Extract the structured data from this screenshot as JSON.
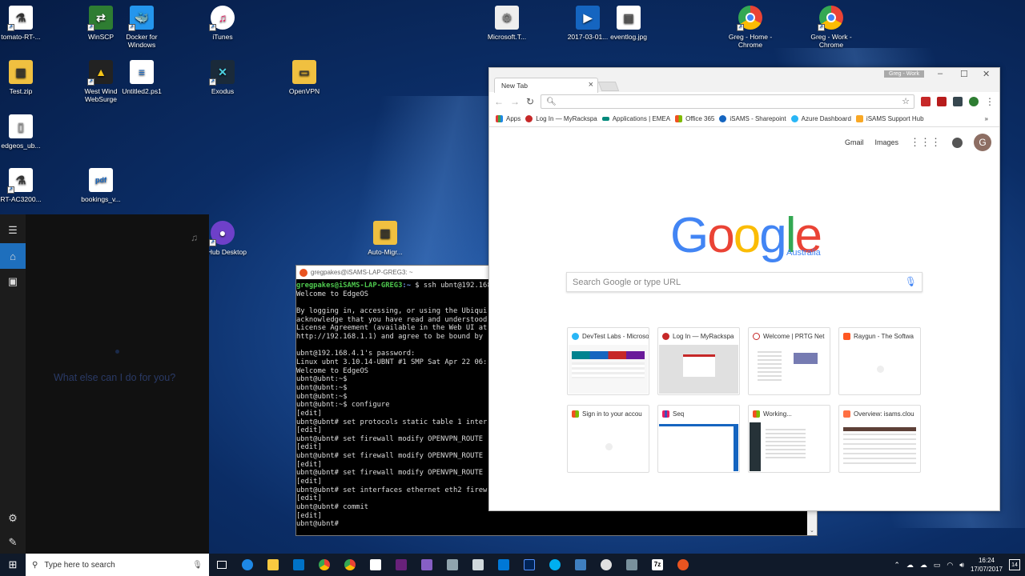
{
  "desktop": {
    "icons": [
      {
        "label": "tomato-RT-..."
      },
      {
        "label": "WinSCP"
      },
      {
        "label": "Docker for Windows"
      },
      {
        "label": "iTunes"
      },
      {
        "label": "Test.zip"
      },
      {
        "label": "West Wind WebSurge"
      },
      {
        "label": "Untitled2.ps1"
      },
      {
        "label": "Exodus"
      },
      {
        "label": "OpenVPN"
      },
      {
        "label": "edgeos_ub..."
      },
      {
        "label": "RT-AC3200..."
      },
      {
        "label": "bookings_v..."
      },
      {
        "label": "GitHub Desktop"
      },
      {
        "label": "Auto-Migr..."
      },
      {
        "label": "Microsoft.T..."
      },
      {
        "label": "2017-03-01..."
      },
      {
        "label": "eventlog.jpg"
      },
      {
        "label": "Greg - Home - Chrome"
      },
      {
        "label": "Greg - Work - Chrome"
      }
    ]
  },
  "cortana": {
    "prompt": "What else can I do for you?"
  },
  "terminal": {
    "title": "gregpakes@iSAMS-LAP-GREG3: ~",
    "prompt_user": "gregpakes@iSAMS-LAP-GREG3",
    "prompt_path": ":~",
    "first_command": "$ ssh ubnt@192.168",
    "lines": [
      "Welcome to EdgeOS",
      "",
      "By logging in, accessing, or using the Ubiqui",
      "acknowledge that you have read and understood",
      "License Agreement (available in the Web UI at",
      "http://192.168.1.1) and agree to be bound by",
      "",
      "ubnt@192.168.4.1's password:",
      "Linux ubnt 3.10.14-UBNT #1 SMP Sat Apr 22 06:",
      "Welcome to EdgeOS",
      "ubnt@ubnt:~$",
      "ubnt@ubnt:~$",
      "ubnt@ubnt:~$",
      "ubnt@ubnt:~$ configure",
      "[edit]",
      "ubnt@ubnt# set protocols static table 1 inter",
      "[edit]",
      "ubnt@ubnt# set firewall modify OPENVPN_ROUTE",
      "[edit]",
      "ubnt@ubnt# set firewall modify OPENVPN_ROUTE",
      "[edit]",
      "ubnt@ubnt# set firewall modify OPENVPN_ROUTE",
      "[edit]",
      "ubnt@ubnt# set interfaces ethernet eth2 firew",
      "[edit]",
      "ubnt@ubnt# commit",
      "[edit]",
      "ubnt@ubnt#"
    ]
  },
  "chrome": {
    "tab_title": "New Tab",
    "profile": "Greg - Work",
    "omnibox_value": "",
    "bookmarks": [
      "Apps",
      "Log In — MyRackspa",
      "Applications | EMEA",
      "Office 365",
      "iSAMS - Sharepoint",
      "Azure Dashboard",
      "iSAMS Support Hub"
    ],
    "bookmarks_more": "»",
    "gmail": "Gmail",
    "images": "Images",
    "avatar_letter": "G",
    "logo_region": "Australia",
    "search_placeholder": "Search Google or type URL",
    "tiles": [
      {
        "title": "DevTest Labs - Microso"
      },
      {
        "title": "Log In — MyRackspa"
      },
      {
        "title": "Welcome | PRTG Net"
      },
      {
        "title": "Raygun - The Softwa"
      },
      {
        "title": "Sign in to your accou"
      },
      {
        "title": "Seq"
      },
      {
        "title": "Working..."
      },
      {
        "title": "Overview: isams.clou"
      }
    ]
  },
  "taskbar": {
    "search_placeholder": "Type here to search",
    "time": "16:24",
    "date": "17/07/2017",
    "notifications": "14"
  }
}
